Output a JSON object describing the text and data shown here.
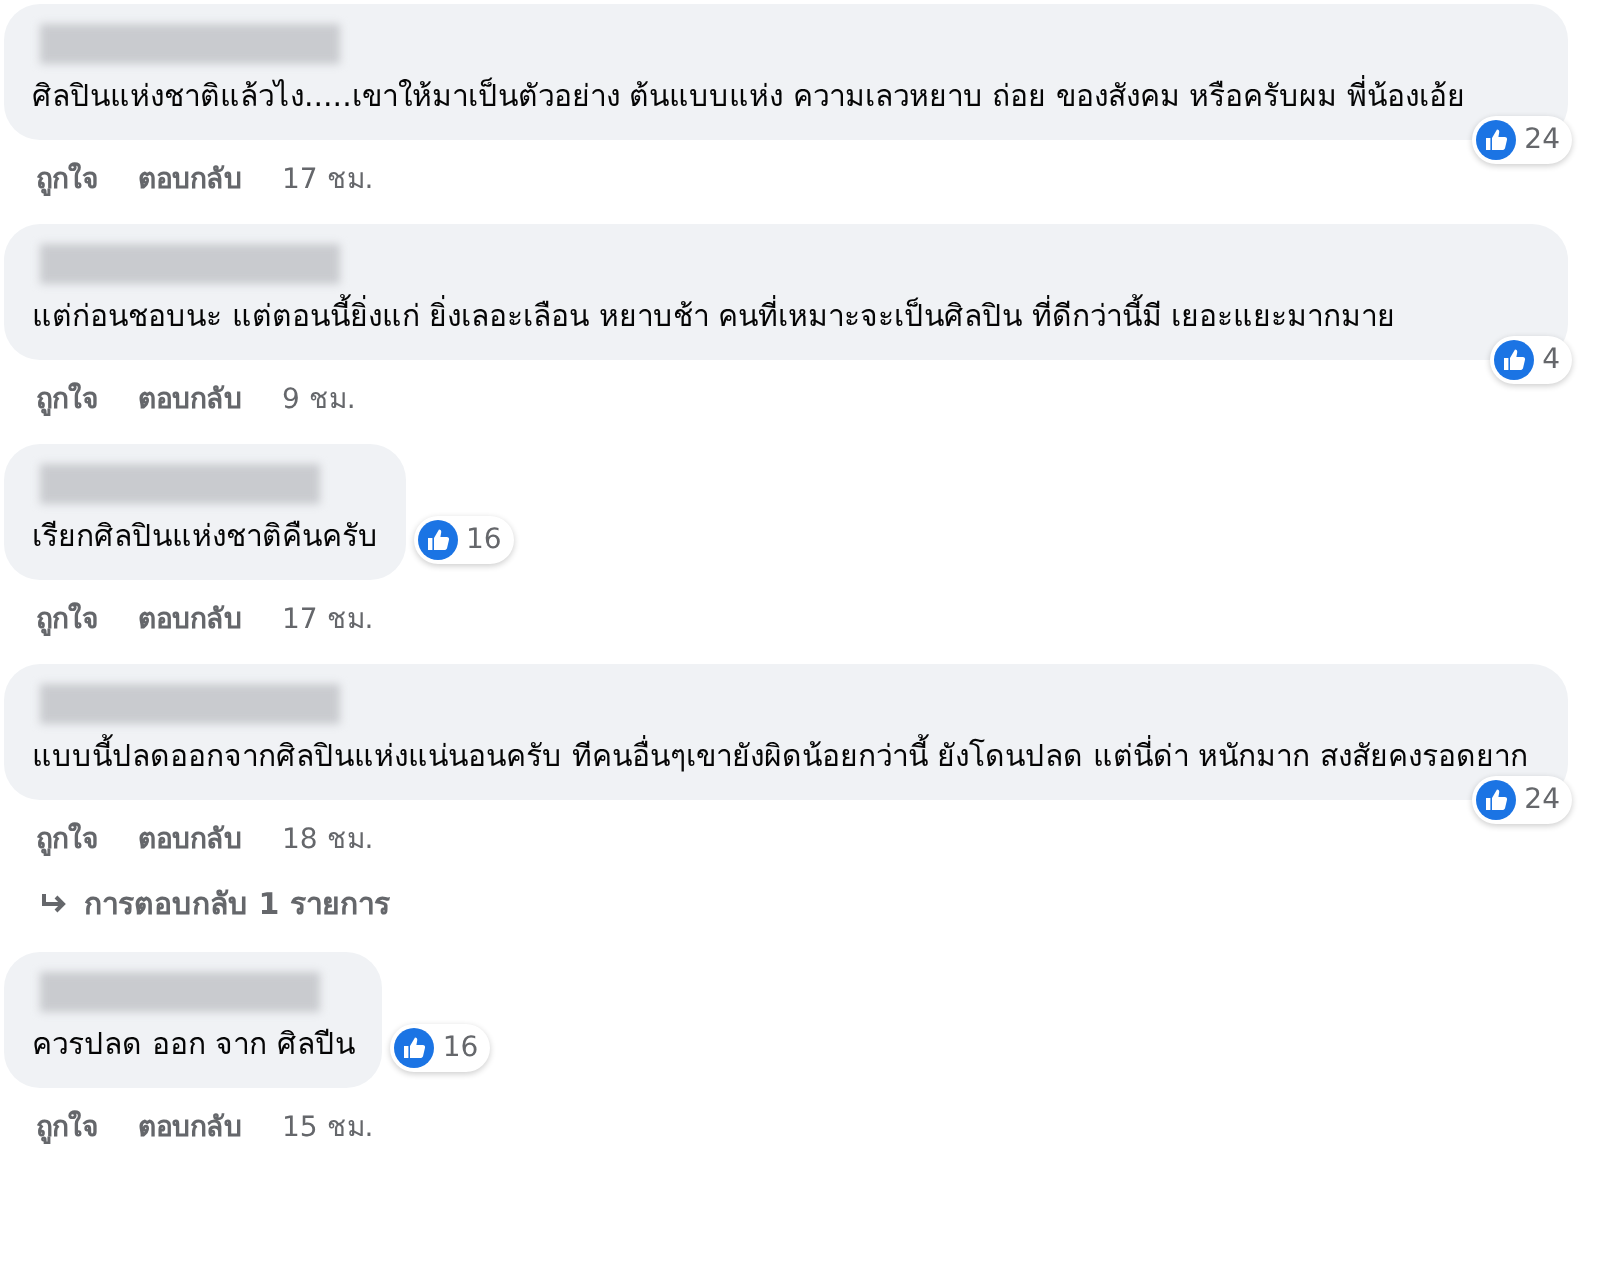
{
  "comments": [
    {
      "kind": "wide",
      "text": "ศิลปินแห่งชาติแล้วไง.....เขาให้มาเป็นตัวอย่าง ต้นแบบแห่ง ความเลวหยาบ ถ่อย ของสังคม หรือครับผม พี่น้องเอ้ย",
      "reactions": "24",
      "like": "ถูกใจ",
      "reply": "ตอบกลับ",
      "time": "17 ชม."
    },
    {
      "kind": "wide",
      "text": "แต่ก่อนชอบนะ แต่ตอนนี้ยิ่งแก่ ยิ่งเลอะเลือน หยาบช้า คนที่เหมาะจะเป็นศิลปิน ที่ดีกว่านี้มี เยอะแยะมากมาย",
      "reactions": "4",
      "like": "ถูกใจ",
      "reply": "ตอบกลับ",
      "time": "9 ชม."
    },
    {
      "kind": "compact",
      "text": "เรียกศิลปินแห่งชาติคืนครับ",
      "reactions": "16",
      "like": "ถูกใจ",
      "reply": "ตอบกลับ",
      "time": "17 ชม."
    },
    {
      "kind": "wide",
      "text": "แบบนี้ปลดออกจากศิลปินแห่งแน่นอนครับ ทีคนอื่นๆเขายังผิดน้อยกว่านี้ ยังโดนปลด แต่นี่ด่า หนักมาก สงสัยคงรอดยาก",
      "reactions": "24",
      "like": "ถูกใจ",
      "reply": "ตอบกลับ",
      "time": "18 ชม.",
      "replies": "การตอบกลับ 1 รายการ"
    },
    {
      "kind": "compact",
      "text": "ควรปลด ออก จาก ศิลปีน",
      "reactions": "16",
      "like": "ถูกใจ",
      "reply": "ตอบกลับ",
      "time": "15 ชม."
    }
  ]
}
